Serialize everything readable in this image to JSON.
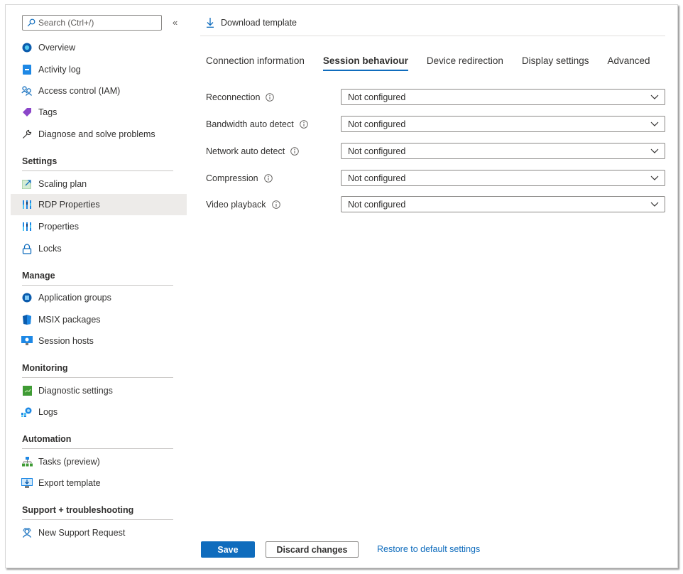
{
  "sidebar": {
    "search_placeholder": "Search (Ctrl+/)",
    "collapse_label": "«",
    "top_items": [
      {
        "label": "Overview",
        "icon": "overview-icon"
      },
      {
        "label": "Activity log",
        "icon": "activity-log-icon"
      },
      {
        "label": "Access control (IAM)",
        "icon": "access-control-icon"
      },
      {
        "label": "Tags",
        "icon": "tag-icon"
      },
      {
        "label": "Diagnose and solve problems",
        "icon": "wrench-icon"
      }
    ],
    "sections": [
      {
        "title": "Settings",
        "items": [
          {
            "label": "Scaling plan",
            "icon": "scaling-plan-icon"
          },
          {
            "label": "RDP Properties",
            "icon": "properties-icon",
            "active": true
          },
          {
            "label": "Properties",
            "icon": "properties-icon"
          },
          {
            "label": "Locks",
            "icon": "lock-icon"
          }
        ]
      },
      {
        "title": "Manage",
        "items": [
          {
            "label": "Application groups",
            "icon": "application-groups-icon"
          },
          {
            "label": "MSIX packages",
            "icon": "msix-package-icon"
          },
          {
            "label": "Session hosts",
            "icon": "session-hosts-icon"
          }
        ]
      },
      {
        "title": "Monitoring",
        "items": [
          {
            "label": "Diagnostic settings",
            "icon": "diagnostic-settings-icon"
          },
          {
            "label": "Logs",
            "icon": "logs-icon"
          }
        ]
      },
      {
        "title": "Automation",
        "items": [
          {
            "label": "Tasks (preview)",
            "icon": "tasks-icon"
          },
          {
            "label": "Export template",
            "icon": "export-template-icon"
          }
        ]
      },
      {
        "title": "Support + troubleshooting",
        "items": [
          {
            "label": "New Support Request",
            "icon": "support-request-icon"
          }
        ]
      }
    ]
  },
  "toolbar": {
    "download_label": "Download template"
  },
  "tabs": [
    {
      "label": "Connection information",
      "active": false
    },
    {
      "label": "Session behaviour",
      "active": true
    },
    {
      "label": "Device redirection",
      "active": false
    },
    {
      "label": "Display settings",
      "active": false
    },
    {
      "label": "Advanced",
      "active": false
    }
  ],
  "settings": [
    {
      "label": "Reconnection",
      "value": "Not configured"
    },
    {
      "label": "Bandwidth auto detect",
      "value": "Not configured"
    },
    {
      "label": "Network auto detect",
      "value": "Not configured"
    },
    {
      "label": "Compression",
      "value": "Not configured"
    },
    {
      "label": "Video playback",
      "value": "Not configured"
    }
  ],
  "footer": {
    "save_label": "Save",
    "discard_label": "Discard changes",
    "restore_label": "Restore to default settings"
  },
  "colors": {
    "accent": "#0f6cbd",
    "active_nav_bg": "#edebe9"
  }
}
